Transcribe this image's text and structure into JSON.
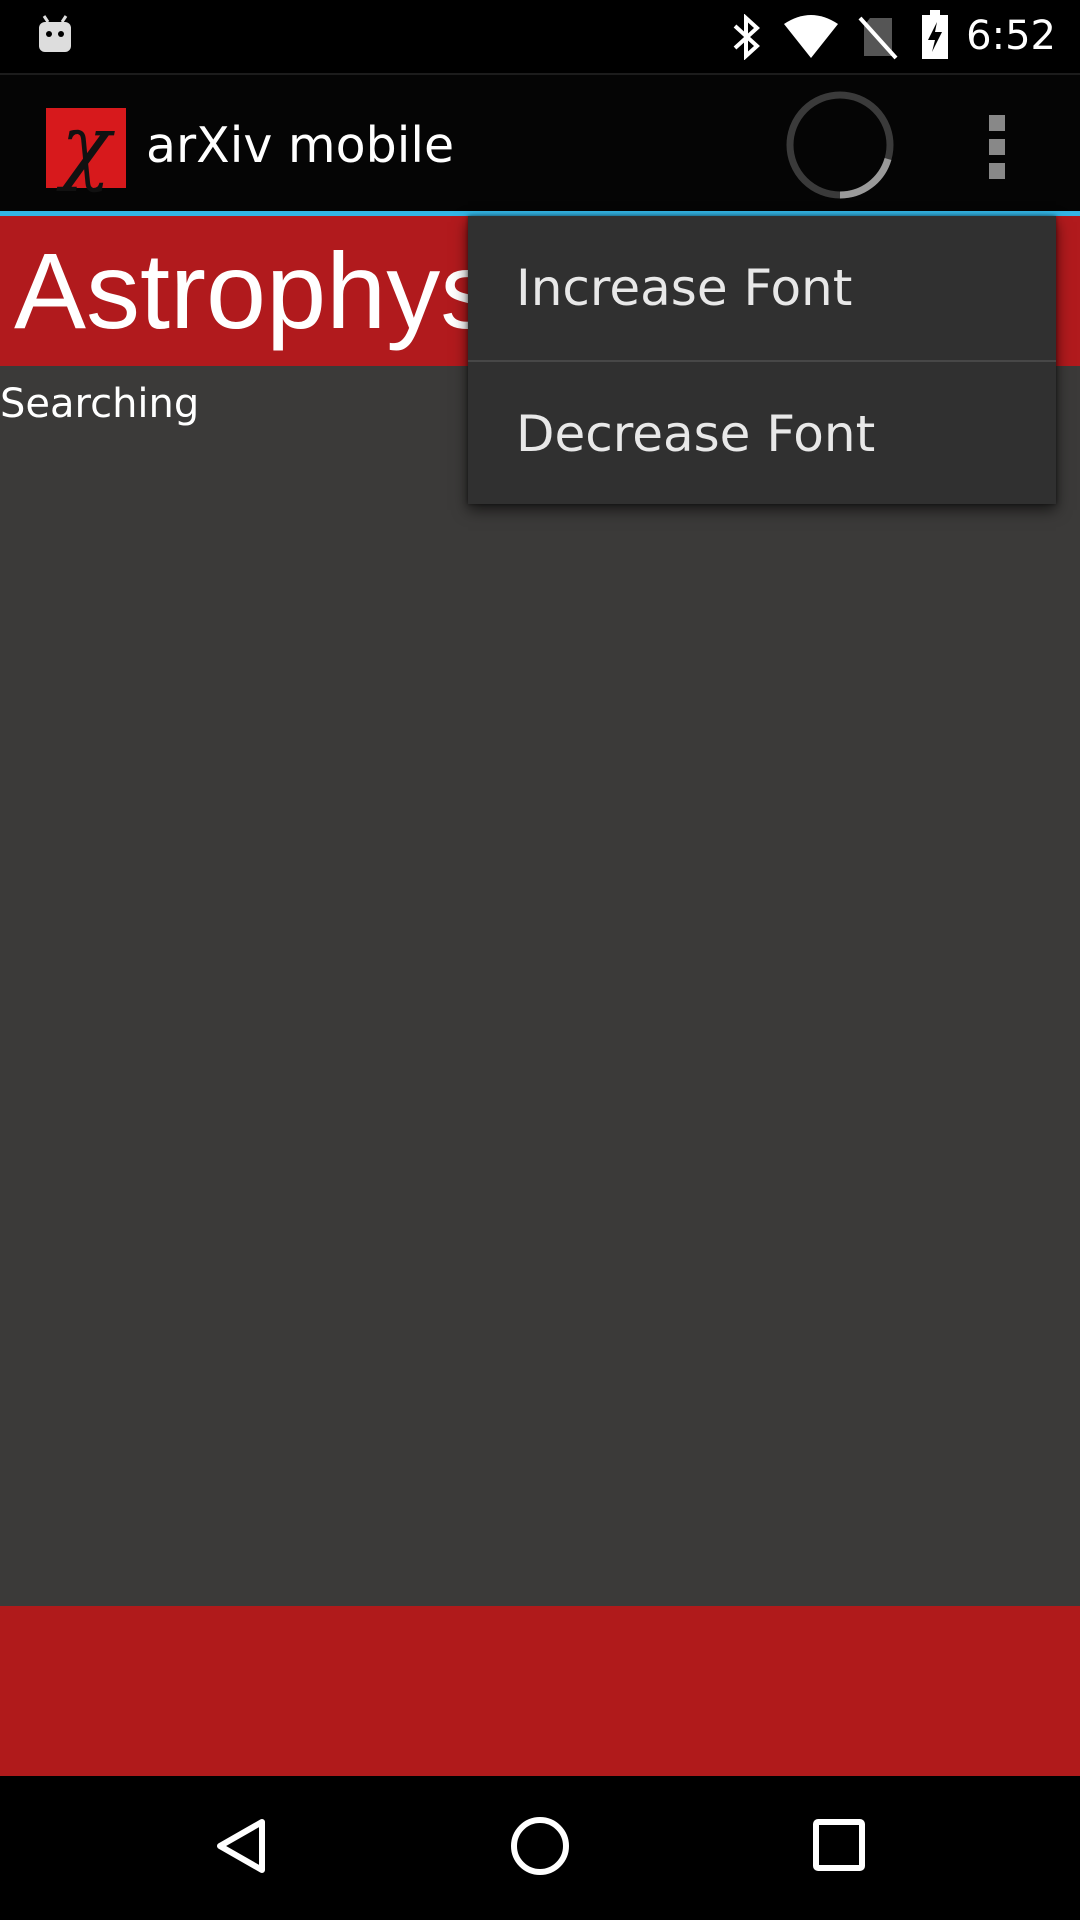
{
  "status_bar": {
    "time": "6:52",
    "icons": [
      "android-notification-icon",
      "bluetooth-icon",
      "wifi-icon",
      "no-sim-icon",
      "battery-charging-icon"
    ]
  },
  "action_bar": {
    "app_icon_glyph": "χ",
    "app_title": "arXiv mobile",
    "accent_color": "#33b5e5"
  },
  "category": {
    "title": "Astrophysics"
  },
  "content": {
    "status_text": "Searching"
  },
  "overflow_menu": {
    "items": [
      {
        "label": "Increase Font"
      },
      {
        "label": "Decrease Font"
      }
    ]
  },
  "colors": {
    "brand_red": "#b11a1d",
    "content_bg": "#3b3a39",
    "menu_bg": "#303030"
  }
}
